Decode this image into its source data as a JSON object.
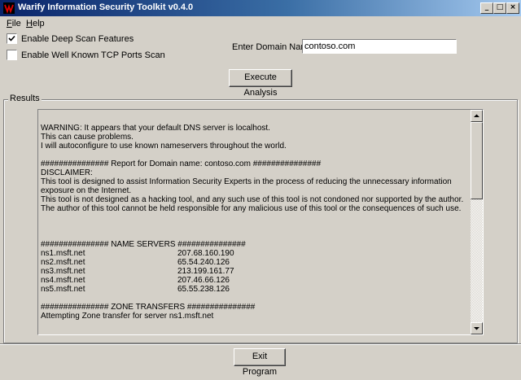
{
  "window": {
    "title": "Warify Information Security Toolkit v0.4.0",
    "controls": [
      "_",
      "□",
      "×"
    ]
  },
  "menu": {
    "file_first": "F",
    "file_rest": "ile",
    "help_first": "H",
    "help_rest": "elp"
  },
  "options": {
    "deep_scan_label": "Enable Deep Scan Features",
    "deep_scan_checked": true,
    "tcp_ports_label": "Enable Well Known TCP Ports Scan",
    "tcp_ports_checked": false
  },
  "domain": {
    "label": "Enter Domain Name",
    "value": "contoso.com"
  },
  "execute_button": "Execute Analysis",
  "results": {
    "group_label": "Results",
    "warning": [
      "WARNING: It appears that your default DNS server is localhost.",
      "This can cause problems.",
      "I will autoconfigure to use known nameservers throughout the world."
    ],
    "report_header": "###############  Report for Domain name: contoso.com  ###############",
    "disclaimer_title": "DISCLAIMER:",
    "disclaimer_1": "This tool is designed to assist Information Security Experts in the process of reducing the unnecessary information exposure on the Internet.",
    "disclaimer_2": "This tool is not designed as a hacking tool, and any such use of this tool is not condoned nor supported by the author.",
    "disclaimer_3": "The author of this tool cannot be held responsible for any malicious use of this tool or the consequences of such use.",
    "ns_header": "###############  NAME SERVERS ###############",
    "name_servers": [
      {
        "host": "ns1.msft.net",
        "ip": "207.68.160.190"
      },
      {
        "host": "ns2.msft.net",
        "ip": "65.54.240.126"
      },
      {
        "host": "ns3.msft.net",
        "ip": "213.199.161.77"
      },
      {
        "host": "ns4.msft.net",
        "ip": "207.46.66.126"
      },
      {
        "host": "ns5.msft.net",
        "ip": "65.55.238.126"
      }
    ],
    "zone_header": "###############  ZONE TRANSFERS  ###############",
    "zone_line": "Attempting Zone transfer for server ns1.msft.net"
  },
  "exit_button": "Exit  Program",
  "colors": {
    "face": "#d4d0c8",
    "title_start": "#0a246a",
    "title_end": "#a6caf0"
  }
}
